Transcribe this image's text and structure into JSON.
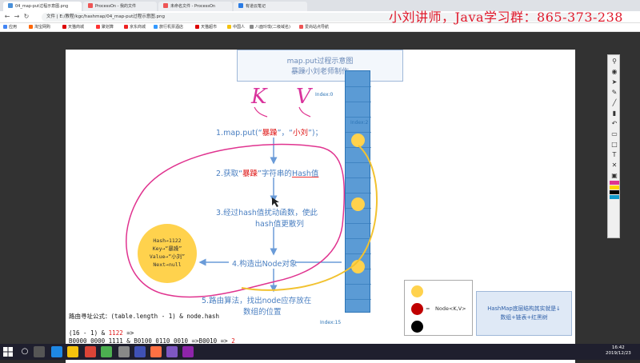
{
  "tabs": [
    {
      "label": "04_map-put过程示意图.png",
      "active": true,
      "color": "#4a90d9"
    },
    {
      "label": "ProcessOn - 我的文件",
      "active": false,
      "color": "#e55"
    },
    {
      "label": "未命名文件 - ProcessOn",
      "active": false,
      "color": "#e55"
    },
    {
      "label": "有道云笔记",
      "active": false,
      "color": "#2a7be4"
    }
  ],
  "address": "文件 | E:/教程/kgc/hashmap/04_map-put过程示意图.png",
  "bookmarks": [
    "应用",
    "淘宝网购",
    "天猫商城",
    "聚划算",
    "京东商城",
    "旅行机票酒店",
    "天猫超市",
    "中国人",
    "八面玲珑(二级域名)",
    "爱尚站点导航"
  ],
  "watermark": "小刘讲师，Java学习群：865-373-238",
  "slide": {
    "title_line1": "map.put过程示意图",
    "title_line2": "暴躁小刘老师制作",
    "kv_k": "K",
    "kv_v": "V",
    "step1_prefix": "1.map.put(“",
    "step1_key": "暴躁",
    "step1_mid": "”，“",
    "step1_val": "小刘",
    "step1_suffix": "”)；",
    "step2_a": "2.获取“",
    "step2_key": "暴躁",
    "step2_b": "”字符串的",
    "step2_hl": "Hash值",
    "step3_line1": "3.经过hash值扰动函数，使此",
    "step3_line2": "hash值更散列",
    "step4": "4.构造出Node对象",
    "step5_line1": "5.路由算法，找出node应存放在",
    "step5_line2": "数组的位置",
    "index0": "Index:0",
    "index2": "Index:2",
    "index15": "Index:15",
    "node_hash": "Hash→1122",
    "node_key": "Key→“暴躁”",
    "node_value": "Value→“小刘”",
    "node_next": "Next→null",
    "formula": "路由寻址公式：(table.length - 1) & node.hash",
    "calc1_a": "(16 - 1) & ",
    "calc1_b": "1122",
    "calc1_c": " =>",
    "calc2_a": "B0000 0000 1111 & B0100 0110 0010 =>B0010 => ",
    "calc2_b": "2",
    "legend_eq": "=",
    "legend_text": "Node<K,V>",
    "note_line1": "HashMap底层结构其实就是↓",
    "note_line2": "数组+链表+红黑树"
  },
  "colors": {
    "accent_blue": "#4a7fc1",
    "array_blue": "#5b9bd5",
    "node_yellow": "#ffd24d",
    "pink_annotation": "#e0338f",
    "red": "#d11111"
  },
  "clock": {
    "time": "16:42",
    "date": "2019/12/23"
  }
}
